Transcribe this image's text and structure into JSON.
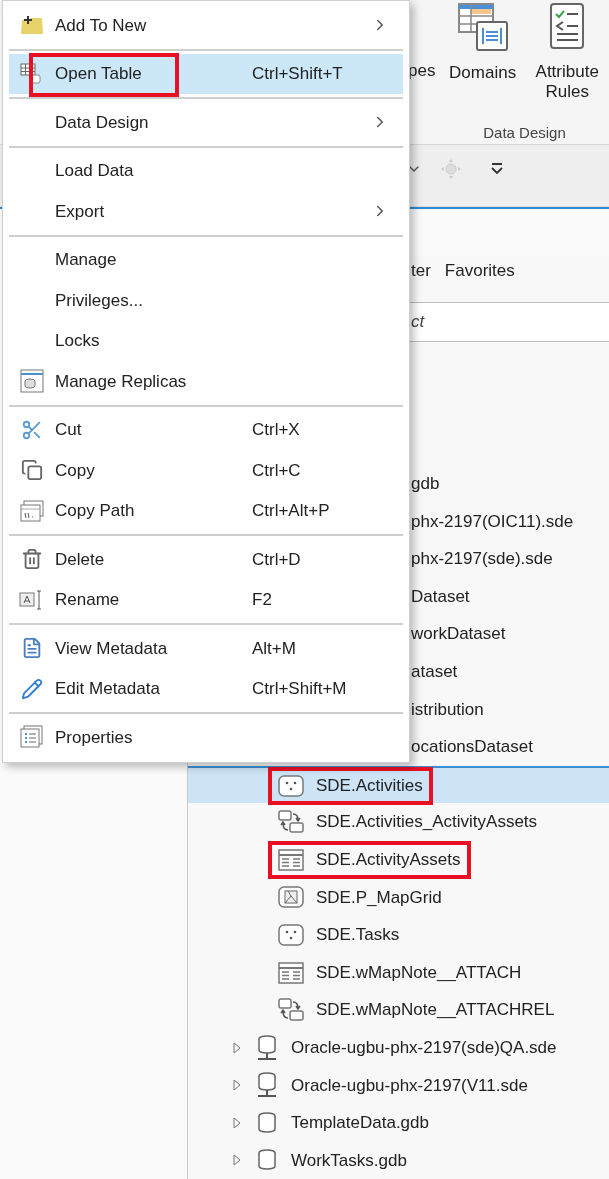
{
  "ribbon": {
    "buttons": [
      {
        "label": "pes"
      },
      {
        "label": "Domains"
      },
      {
        "label": "Attribute Rules"
      }
    ],
    "group_label": "Data Design"
  },
  "catalog": {
    "tabs": [
      {
        "label": "ter"
      },
      {
        "label": "Favorites"
      }
    ],
    "search": {
      "placeholder": "ct"
    }
  },
  "tree": {
    "clipped_rows": [
      "gdb",
      "phx-2197(OIC11).sde",
      "phx-2197(sde).sde",
      "Dataset",
      "workDataset",
      "ataset",
      "istribution",
      "ocationsDataset"
    ],
    "child_rows": [
      {
        "label": "SDE.Activities",
        "kind": "point",
        "selected": true,
        "annotated": true
      },
      {
        "label": "SDE.Activities_ActivityAssets",
        "kind": "relationship",
        "selected": false,
        "annotated": false
      },
      {
        "label": "SDE.ActivityAssets",
        "kind": "table",
        "selected": false,
        "annotated": true
      },
      {
        "label": "SDE.P_MapGrid",
        "kind": "polygon",
        "selected": false,
        "annotated": false
      },
      {
        "label": "SDE.Tasks",
        "kind": "point",
        "selected": false,
        "annotated": false
      },
      {
        "label": "SDE.wMapNote__ATTACH",
        "kind": "table",
        "selected": false,
        "annotated": false
      },
      {
        "label": "SDE.wMapNote__ATTACHREL",
        "kind": "relationship",
        "selected": false,
        "annotated": false
      }
    ],
    "rows": [
      {
        "label": "Oracle-ugbu-phx-2197(sde)QA.sde",
        "kind": "enterprise",
        "expanded": false
      },
      {
        "label": "Oracle-ugbu-phx-2197(V11.sde",
        "kind": "enterprise",
        "expanded": false
      },
      {
        "label": "TemplateData.gdb",
        "kind": "file",
        "expanded": false
      },
      {
        "label": "WorkTasks.gdb",
        "kind": "file",
        "expanded": false
      }
    ]
  },
  "menu": {
    "items": [
      {
        "kind": "item",
        "label": "Add To New",
        "submenu": true,
        "selected": false,
        "annotated": false
      },
      {
        "kind": "separator"
      },
      {
        "kind": "item",
        "label": "Open Table",
        "shortcut": "Ctrl+Shift+T",
        "submenu": false,
        "selected": true,
        "annotated": true
      },
      {
        "kind": "separator"
      },
      {
        "kind": "item",
        "label": "Data Design",
        "submenu": true,
        "selected": false,
        "annotated": false
      },
      {
        "kind": "separator"
      },
      {
        "kind": "item",
        "label": "Load Data",
        "submenu": false,
        "selected": false,
        "annotated": false
      },
      {
        "kind": "item",
        "label": "Export",
        "submenu": true,
        "selected": false,
        "annotated": false
      },
      {
        "kind": "separator"
      },
      {
        "kind": "item",
        "label": "Manage",
        "submenu": false,
        "selected": false,
        "annotated": false
      },
      {
        "kind": "item",
        "label": "Privileges...",
        "submenu": false,
        "selected": false,
        "annotated": false
      },
      {
        "kind": "item",
        "label": "Locks",
        "submenu": false,
        "selected": false,
        "annotated": false
      },
      {
        "kind": "item",
        "label": "Manage Replicas",
        "submenu": false,
        "selected": false,
        "annotated": false
      },
      {
        "kind": "separator"
      },
      {
        "kind": "item",
        "label": "Cut",
        "shortcut": "Ctrl+X",
        "submenu": false,
        "selected": false,
        "annotated": false
      },
      {
        "kind": "item",
        "label": "Copy",
        "shortcut": "Ctrl+C",
        "submenu": false,
        "selected": false,
        "annotated": false
      },
      {
        "kind": "item",
        "label": "Copy Path",
        "shortcut": "Ctrl+Alt+P",
        "submenu": false,
        "selected": false,
        "annotated": false
      },
      {
        "kind": "separator"
      },
      {
        "kind": "item",
        "label": "Delete",
        "shortcut": "Ctrl+D",
        "submenu": false,
        "selected": false,
        "annotated": false
      },
      {
        "kind": "item",
        "label": "Rename",
        "shortcut": "F2",
        "submenu": false,
        "selected": false,
        "annotated": false
      },
      {
        "kind": "separator"
      },
      {
        "kind": "item",
        "label": "View Metadata",
        "shortcut": "Alt+M",
        "submenu": false,
        "selected": false,
        "annotated": false
      },
      {
        "kind": "item",
        "label": "Edit Metadata",
        "shortcut": "Ctrl+Shift+M",
        "submenu": false,
        "selected": false,
        "annotated": false
      },
      {
        "kind": "separator"
      },
      {
        "kind": "item",
        "label": "Properties",
        "submenu": false,
        "selected": false,
        "annotated": false
      }
    ]
  }
}
